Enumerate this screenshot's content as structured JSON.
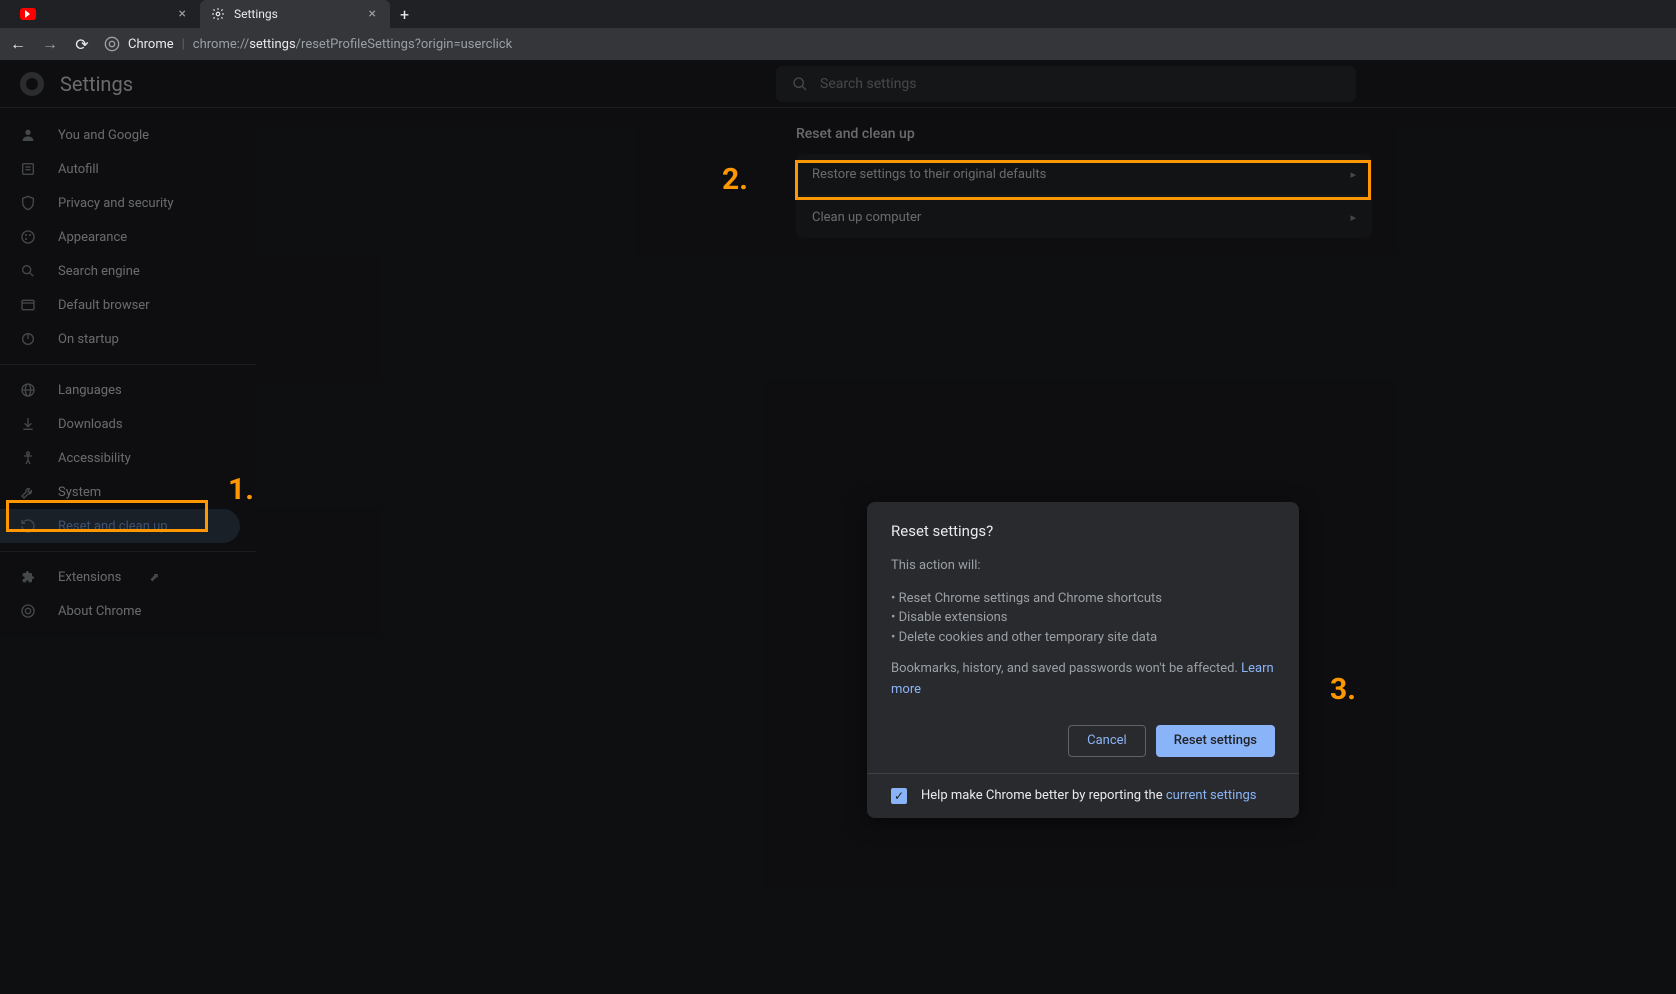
{
  "tabs": [
    {
      "title": ""
    },
    {
      "title": "Settings"
    }
  ],
  "address": {
    "scheme_label": "Chrome",
    "url_pre": "chrome://",
    "url_bold": "settings",
    "url_post": "/resetProfileSettings?origin=userclick"
  },
  "header": {
    "title": "Settings",
    "search_placeholder": "Search settings"
  },
  "sidebar": {
    "items1": [
      {
        "icon": "person",
        "label": "You and Google"
      },
      {
        "icon": "autofill",
        "label": "Autofill"
      },
      {
        "icon": "shield",
        "label": "Privacy and security"
      },
      {
        "icon": "palette",
        "label": "Appearance"
      },
      {
        "icon": "search",
        "label": "Search engine"
      },
      {
        "icon": "browser",
        "label": "Default browser"
      },
      {
        "icon": "power",
        "label": "On startup"
      }
    ],
    "items2": [
      {
        "icon": "globe",
        "label": "Languages"
      },
      {
        "icon": "download",
        "label": "Downloads"
      },
      {
        "icon": "access",
        "label": "Accessibility"
      },
      {
        "icon": "wrench",
        "label": "System"
      },
      {
        "icon": "restore",
        "label": "Reset and clean up",
        "selected": true
      }
    ],
    "items3": [
      {
        "icon": "puzzle",
        "label": "Extensions",
        "external": true
      },
      {
        "icon": "chrome",
        "label": "About Chrome"
      }
    ]
  },
  "main": {
    "section_title": "Reset and clean up",
    "rows": [
      {
        "label": "Restore settings to their original defaults"
      },
      {
        "label": "Clean up computer"
      }
    ]
  },
  "dialog": {
    "title": "Reset settings?",
    "subtitle": "This action will:",
    "bullets": [
      "• Reset Chrome settings and Chrome shortcuts",
      "• Disable extensions",
      "• Delete cookies and other temporary site data"
    ],
    "note_pre": "Bookmarks, history, and saved passwords won't be affected. ",
    "learn_more": "Learn more",
    "cancel": "Cancel",
    "confirm": "Reset settings",
    "footer_pre": "Help make Chrome better by reporting the ",
    "footer_link": "current settings"
  },
  "annotations": {
    "a1": "1.",
    "a2": "2.",
    "a3": "3."
  }
}
